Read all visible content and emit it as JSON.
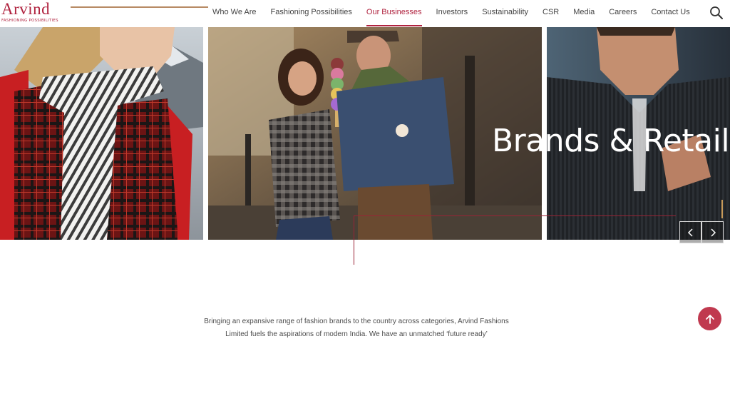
{
  "brand": {
    "name": "Arvind",
    "tagline": "FASHIONING POSSIBILITIES"
  },
  "nav": {
    "items": [
      {
        "label": "Who We Are",
        "active": false
      },
      {
        "label": "Fashioning Possibilities",
        "active": false
      },
      {
        "label": "Our Businesses",
        "active": true
      },
      {
        "label": "Investors",
        "active": false
      },
      {
        "label": "Sustainability",
        "active": false
      },
      {
        "label": "CSR",
        "active": false
      },
      {
        "label": "Media",
        "active": false
      },
      {
        "label": "Careers",
        "active": false
      },
      {
        "label": "Contact Us",
        "active": false
      }
    ],
    "search_icon": "search-icon"
  },
  "hero": {
    "title": "Brands & Retail",
    "prev_icon": "chevron-left-icon",
    "next_icon": "chevron-right-icon"
  },
  "intro": {
    "text": "Bringing an expansive range of fashion brands to the country across categories, Arvind Fashions Limited fuels the aspirations of modern India. We have an unmatched ‘future ready’"
  },
  "scroll_top": {
    "icon": "arrow-up-icon"
  },
  "colors": {
    "brand": "#b0233f",
    "accent_gold": "#b78a63",
    "scroll_top_bg": "#c0394f"
  }
}
